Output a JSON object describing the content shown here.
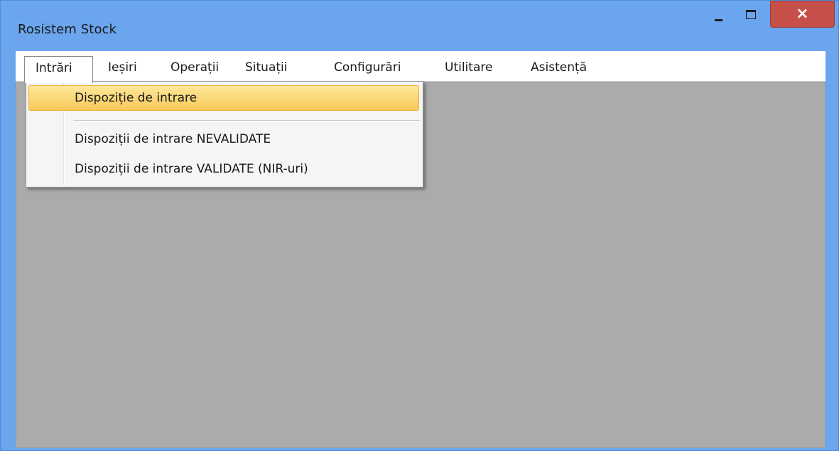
{
  "window": {
    "title": "Rosistem Stock",
    "close_glyph": "×"
  },
  "menubar": {
    "items": [
      {
        "label": "Intrări"
      },
      {
        "label": "Ieșiri"
      },
      {
        "label": "Operații"
      },
      {
        "label": "Situații"
      },
      {
        "label": "Configurări"
      },
      {
        "label": "Utilitare"
      },
      {
        "label": "Asistență"
      }
    ]
  },
  "dropdown": {
    "items": [
      {
        "label": "Dispoziție de intrare"
      },
      {
        "label": "Dispoziții de intrare NEVALIDATE"
      },
      {
        "label": "Dispoziții de intrare VALIDATE (NIR-uri)"
      }
    ]
  },
  "colors": {
    "title_bar": "#6aa5ee",
    "close_button": "#c7504b",
    "client_area": "#ababab",
    "menu_highlight": "#f8c859"
  }
}
